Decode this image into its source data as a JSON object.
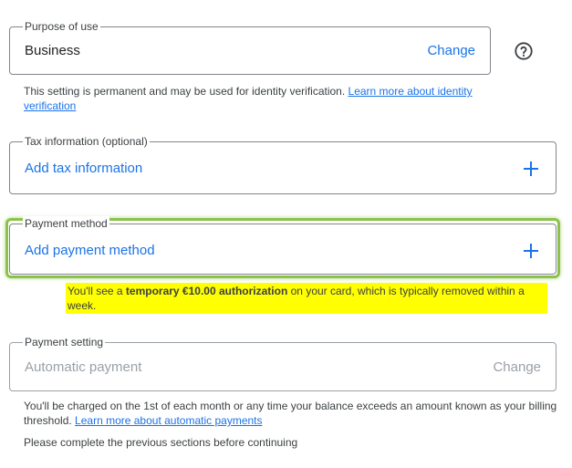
{
  "purpose": {
    "legend": "Purpose of use",
    "value": "Business",
    "action": "Change",
    "note_text": "This setting is permanent and may be used for identity verification. ",
    "note_link": "Learn more about identity verification"
  },
  "tax": {
    "legend": "Tax information (optional)",
    "value": "Add tax information"
  },
  "payment_method": {
    "legend": "Payment method",
    "value": "Add payment method",
    "note_before": "You'll see a ",
    "note_bold": "temporary €10.00 authorization",
    "note_after": " on your card, which is typically removed within a week."
  },
  "payment_setting": {
    "legend": "Payment setting",
    "value": "Automatic payment",
    "action": "Change",
    "note_text": "You'll be charged on the 1st of each month or any time your balance exceeds an amount known as your billing threshold. ",
    "note_link": "Learn more about automatic payments"
  },
  "footer": {
    "text": "Please complete the previous sections before continuing"
  },
  "colors": {
    "accent": "#1a73e8",
    "highlight_ring": "#8bc34a",
    "highlight_note": "#ffff00"
  },
  "icons": {
    "help": "help-circle-icon",
    "add": "plus-icon"
  }
}
